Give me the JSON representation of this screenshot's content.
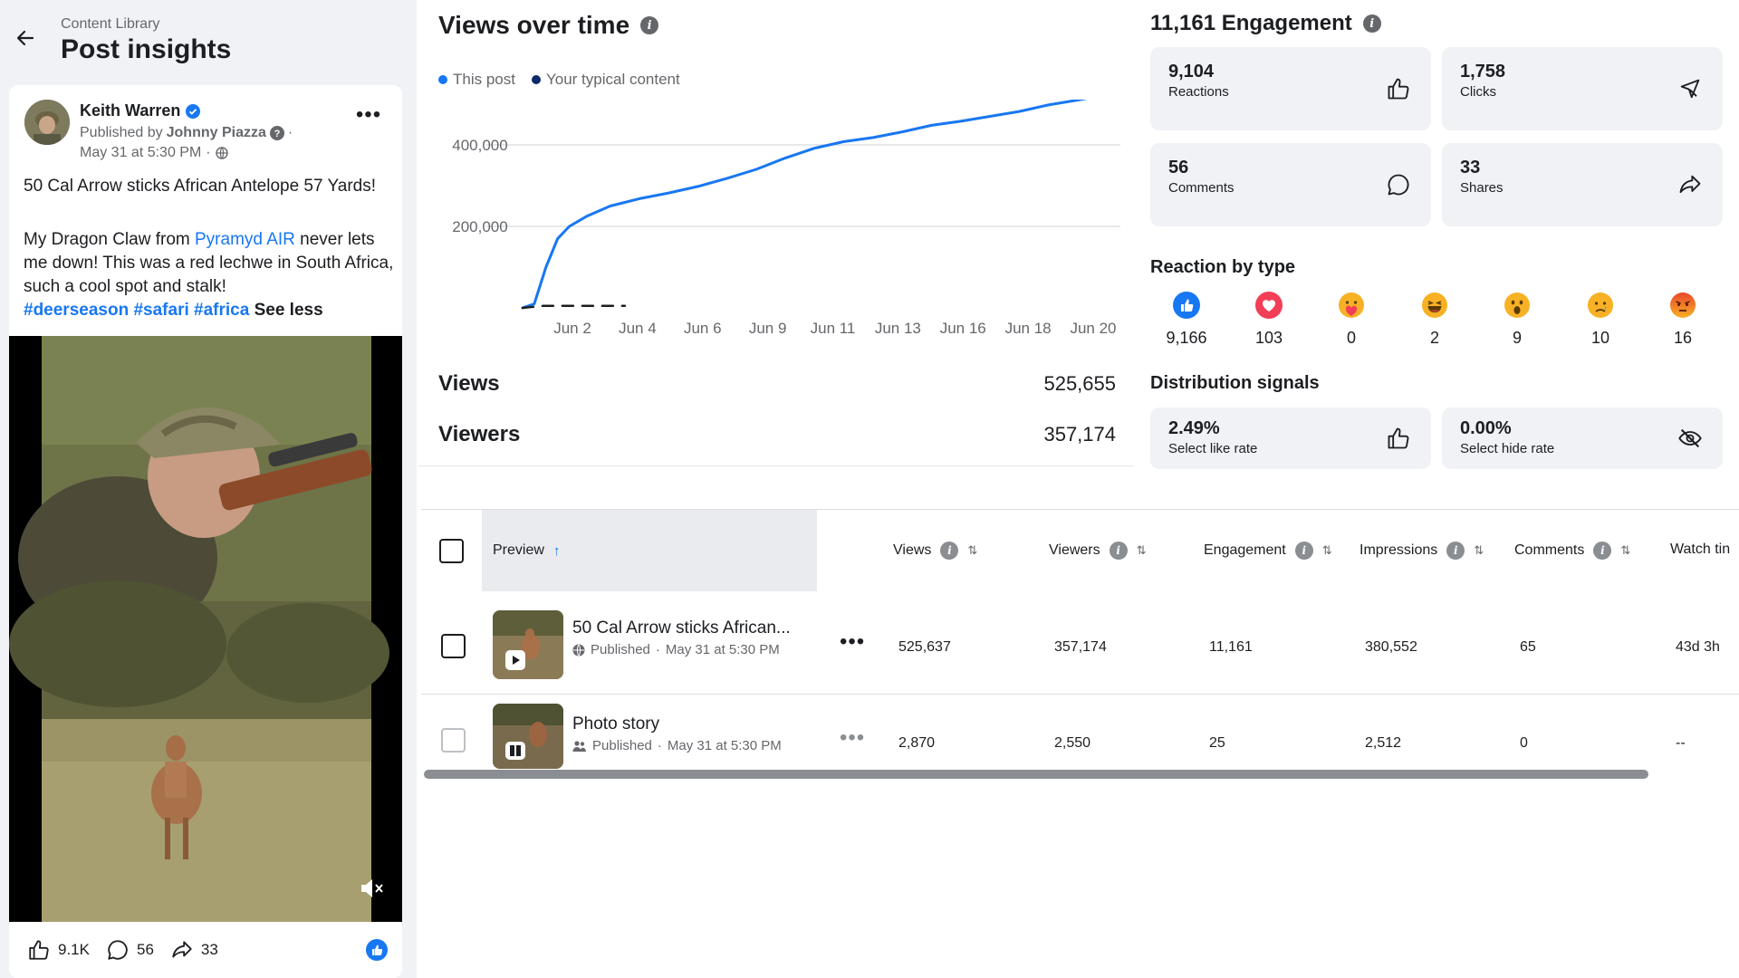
{
  "header": {
    "breadcrumb": "Content Library",
    "title": "Post insights"
  },
  "post": {
    "author": "Keith Warren",
    "published_prefix": "Published by",
    "published_by": "Johnny Piazza",
    "date": "May 31 at 5:30 PM",
    "title": "50 Cal Arrow sticks African Antelope 57 Yards!",
    "body_part1": "My Dragon Claw from ",
    "body_link": "Pyramyd AIR",
    "body_part2": " never lets me down! This was a red lechwe in South Africa, such a cool spot and stalk!",
    "tags": [
      "#deerseason",
      "#safari",
      "#africa"
    ],
    "see_less": "See less",
    "likes": "9.1K",
    "comments": "56",
    "shares": "33"
  },
  "chart": {
    "title": "Views over time",
    "legend": [
      {
        "label": "This post",
        "color": "#1877f2"
      },
      {
        "label": "Your typical content",
        "color": "#0b2a6b"
      }
    ]
  },
  "chart_data": {
    "type": "line",
    "title": "Views over time",
    "x_tick_labels": [
      "Jun 2",
      "Jun 4",
      "Jun 6",
      "Jun 9",
      "Jun 11",
      "Jun 13",
      "Jun 16",
      "Jun 18",
      "Jun 20"
    ],
    "y_tick_labels": [
      "200,000",
      "400,000"
    ],
    "ylim": [
      0,
      500000
    ],
    "series": [
      {
        "name": "This post",
        "color": "#1877f2",
        "style": "solid",
        "x": [
          0,
          0.4,
          0.8,
          1.2,
          1.6,
          2.2,
          3,
          4,
          5,
          6,
          7,
          8,
          9,
          10,
          11,
          12,
          13,
          14,
          15,
          16,
          17,
          18,
          19,
          20
        ],
        "values": [
          0,
          10000,
          100000,
          170000,
          200000,
          225000,
          250000,
          268000,
          282000,
          298000,
          318000,
          340000,
          368000,
          392000,
          408000,
          418000,
          432000,
          448000,
          458000,
          470000,
          482000,
          498000,
          510000,
          523000
        ]
      },
      {
        "name": "Your typical content",
        "color": "#1c1e21",
        "style": "dashed",
        "x": [
          0,
          0.7,
          1.5,
          2.5,
          3.5
        ],
        "values": [
          0,
          5000,
          5000,
          5000,
          5000
        ]
      }
    ]
  },
  "metrics": {
    "views_label": "Views",
    "views_value": "525,655",
    "viewers_label": "Viewers",
    "viewers_value": "357,174"
  },
  "engagement": {
    "title": "11,161 Engagement",
    "cards": [
      {
        "value": "9,104",
        "label": "Reactions",
        "icon": "thumbs-up-icon"
      },
      {
        "value": "1,758",
        "label": "Clicks",
        "icon": "cursor-icon"
      },
      {
        "value": "56",
        "label": "Comments",
        "icon": "comment-icon"
      },
      {
        "value": "33",
        "label": "Shares",
        "icon": "share-icon"
      }
    ],
    "reaction_title": "Reaction by type",
    "reactions": [
      {
        "type": "like",
        "value": "9,166"
      },
      {
        "type": "love",
        "value": "103"
      },
      {
        "type": "care",
        "value": "0"
      },
      {
        "type": "haha",
        "value": "2"
      },
      {
        "type": "wow",
        "value": "9"
      },
      {
        "type": "sad",
        "value": "10"
      },
      {
        "type": "angry",
        "value": "16"
      }
    ],
    "distribution_title": "Distribution signals",
    "distribution": [
      {
        "value": "2.49%",
        "label": "Select like rate",
        "icon": "thumbs-up-icon"
      },
      {
        "value": "0.00%",
        "label": "Select hide rate",
        "icon": "eye-off-icon"
      }
    ]
  },
  "table": {
    "headers": {
      "preview": "Preview",
      "views": "Views",
      "viewers": "Viewers",
      "engagement": "Engagement",
      "impressions": "Impressions",
      "comments": "Comments",
      "watch": "Watch tin"
    },
    "rows": [
      {
        "title": "50 Cal Arrow sticks African...",
        "status": "Published",
        "date": "May 31 at 5:30 PM",
        "views": "525,637",
        "viewers": "357,174",
        "engagement": "11,161",
        "impressions": "380,552",
        "comments": "65",
        "watch": "43d 3h"
      },
      {
        "title": "Photo story",
        "status": "Published",
        "date": "May 31 at 5:30 PM",
        "views": "2,870",
        "viewers": "2,550",
        "engagement": "25",
        "impressions": "2,512",
        "comments": "0",
        "watch": "--"
      }
    ]
  }
}
